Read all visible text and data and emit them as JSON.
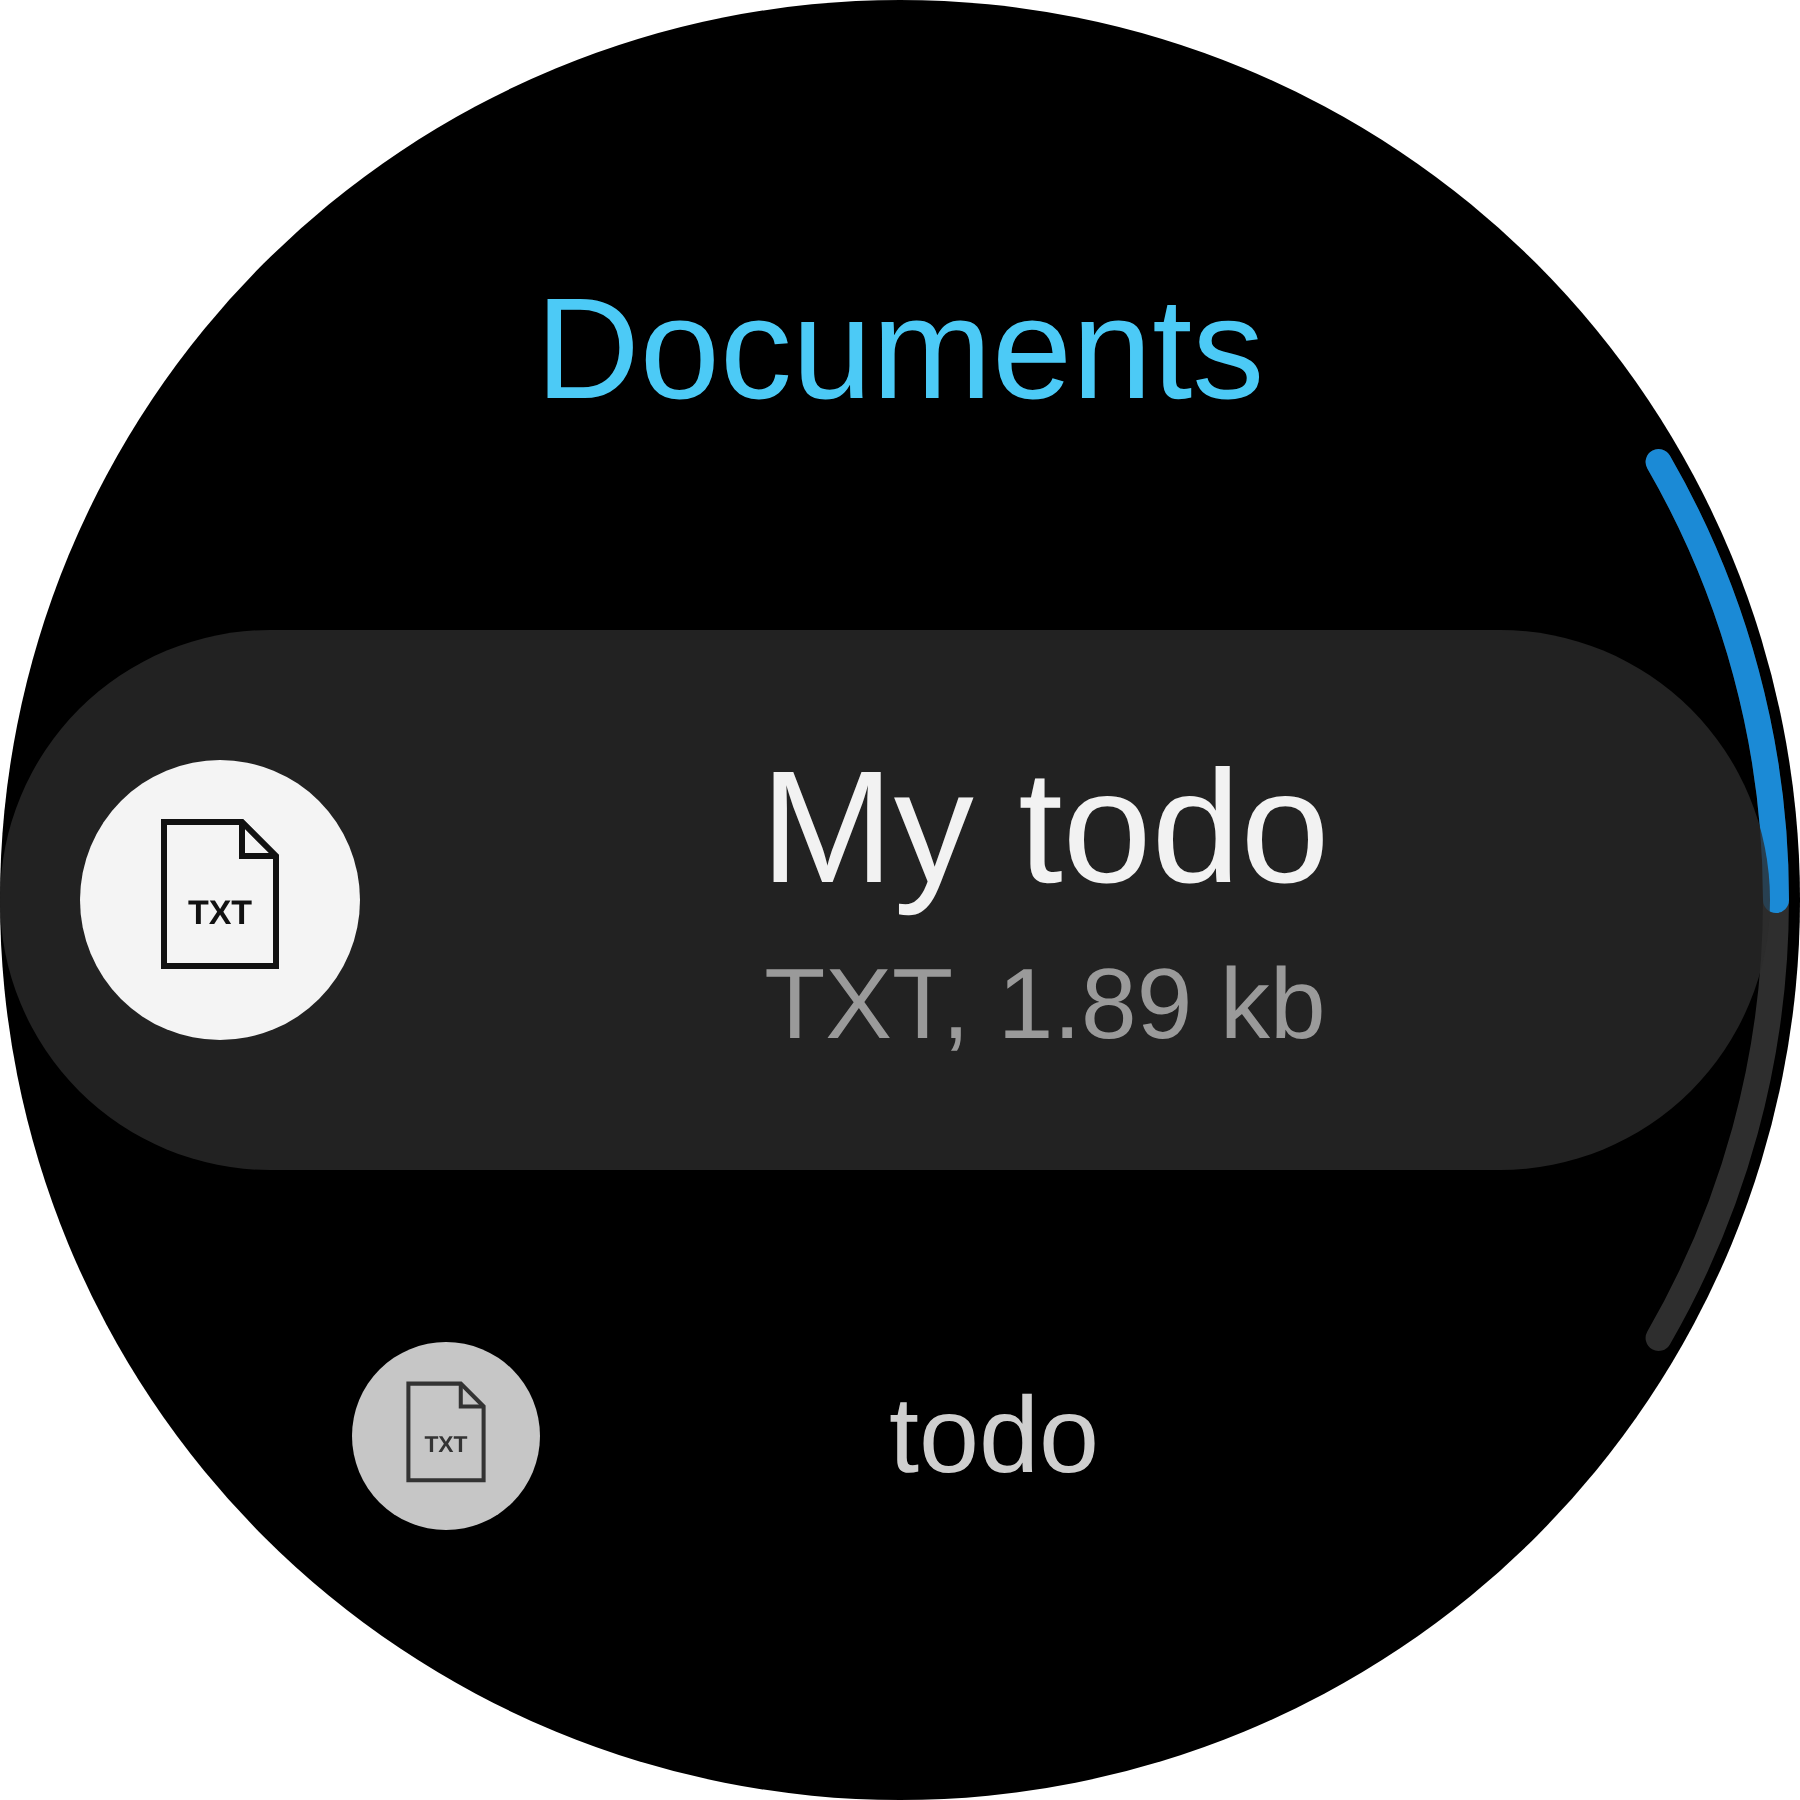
{
  "screen": {
    "title": "Documents"
  },
  "files": [
    {
      "name": "My todo",
      "detail": "TXT, 1.89 kb",
      "icon_label": "TXT",
      "selected": true
    },
    {
      "name": "todo",
      "icon_label": "TXT",
      "selected": false
    }
  ]
}
